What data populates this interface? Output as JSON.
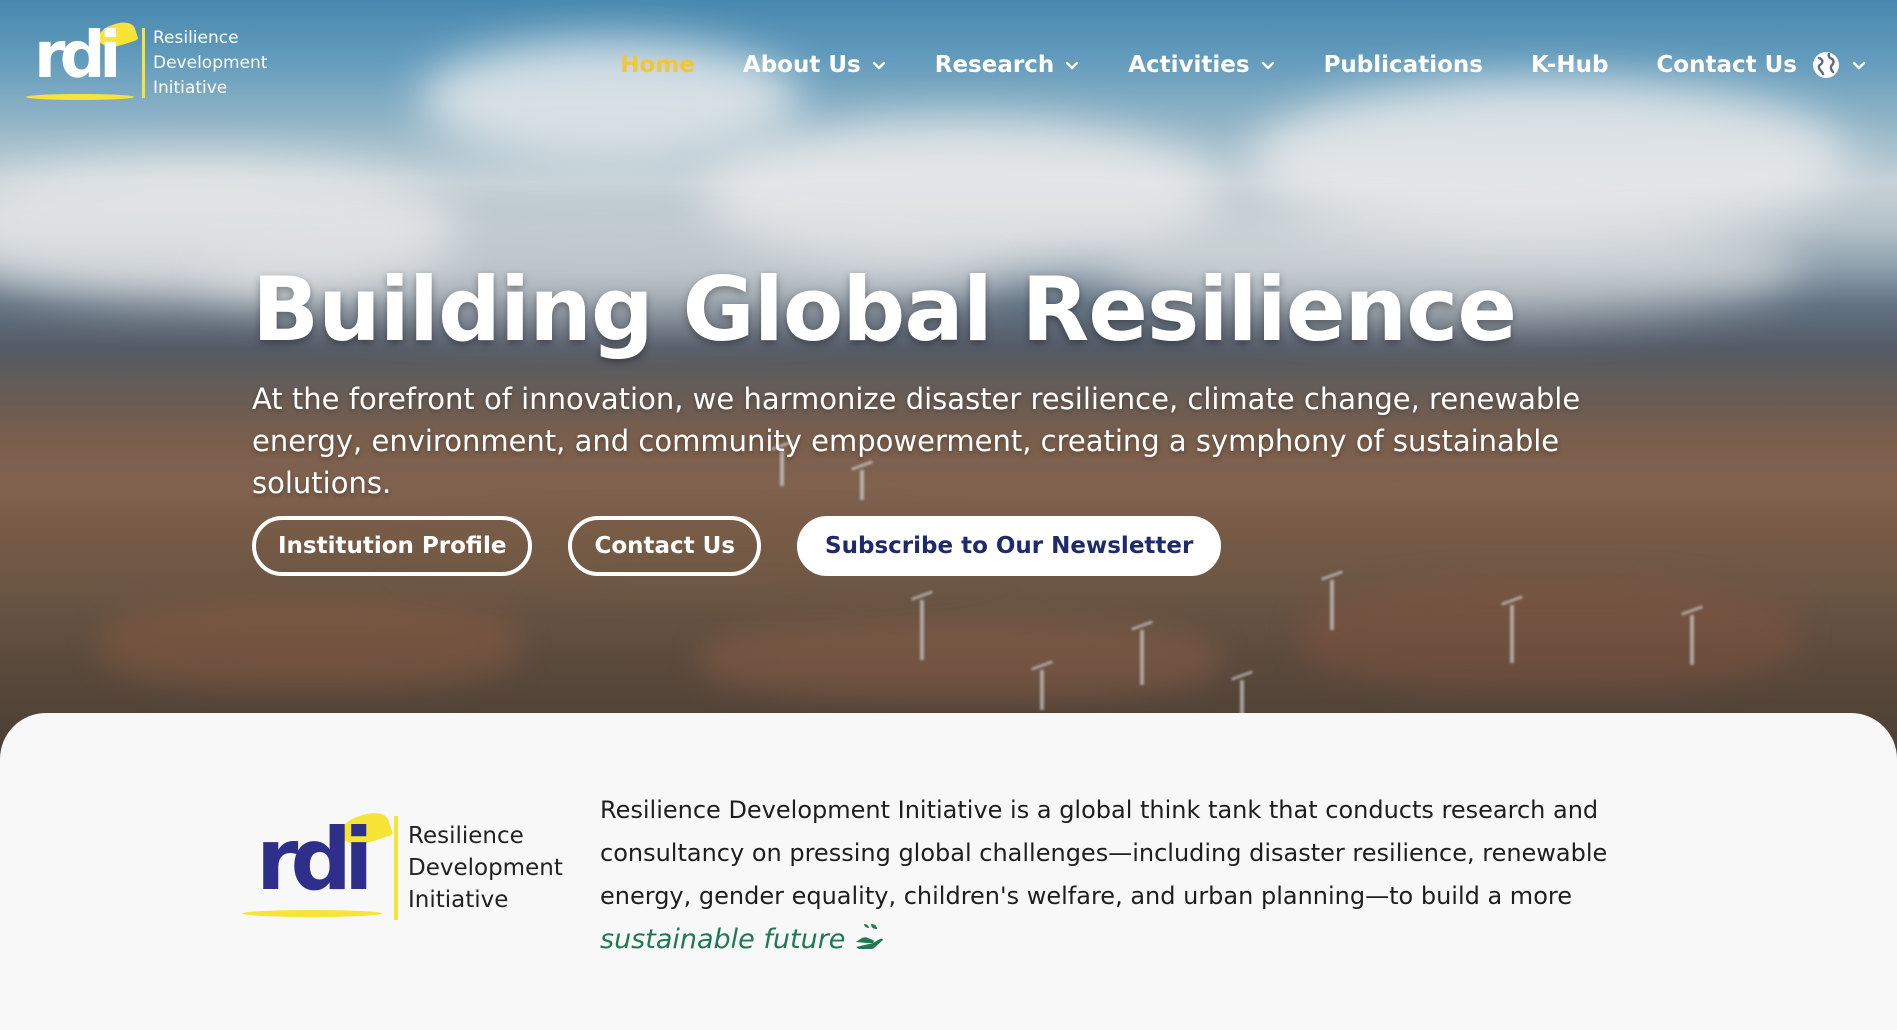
{
  "brand": {
    "mark": "rdi",
    "lines": [
      "Resilience",
      "Development",
      "Initiative"
    ]
  },
  "nav": {
    "items": [
      {
        "label": "Home",
        "active": true,
        "dropdown": false
      },
      {
        "label": "About Us",
        "active": false,
        "dropdown": true
      },
      {
        "label": "Research",
        "active": false,
        "dropdown": true
      },
      {
        "label": "Activities",
        "active": false,
        "dropdown": true
      },
      {
        "label": "Publications",
        "active": false,
        "dropdown": false
      },
      {
        "label": "K-Hub",
        "active": false,
        "dropdown": false
      },
      {
        "label": "Contact Us",
        "active": false,
        "dropdown": false
      }
    ],
    "language_icon": "globe-icon"
  },
  "hero": {
    "title": "Building Global Resilience",
    "subtitle": "At the forefront of innovation, we harmonize disaster resilience, climate change, renewable energy, environment, and community empowerment, creating a symphony of sustainable solutions.",
    "buttons": {
      "profile": "Institution Profile",
      "contact": "Contact Us",
      "newsletter": "Subscribe to Our Newsletter"
    }
  },
  "about": {
    "text": "Resilience Development Initiative is a global think tank that conducts research and consultancy on pressing global challenges—including disaster resilience, renewable energy, gender equality, children's welfare, and urban planning—to build a more ",
    "highlight": "sustainable future",
    "icon": "hand-seedling-icon"
  },
  "colors": {
    "nav_active": "#f3c53a",
    "brand_yellow": "#f7e437",
    "brand_navy": "#2e2f8a",
    "highlight_green": "#1f7a52",
    "newsletter_text": "#1e2a6b"
  }
}
